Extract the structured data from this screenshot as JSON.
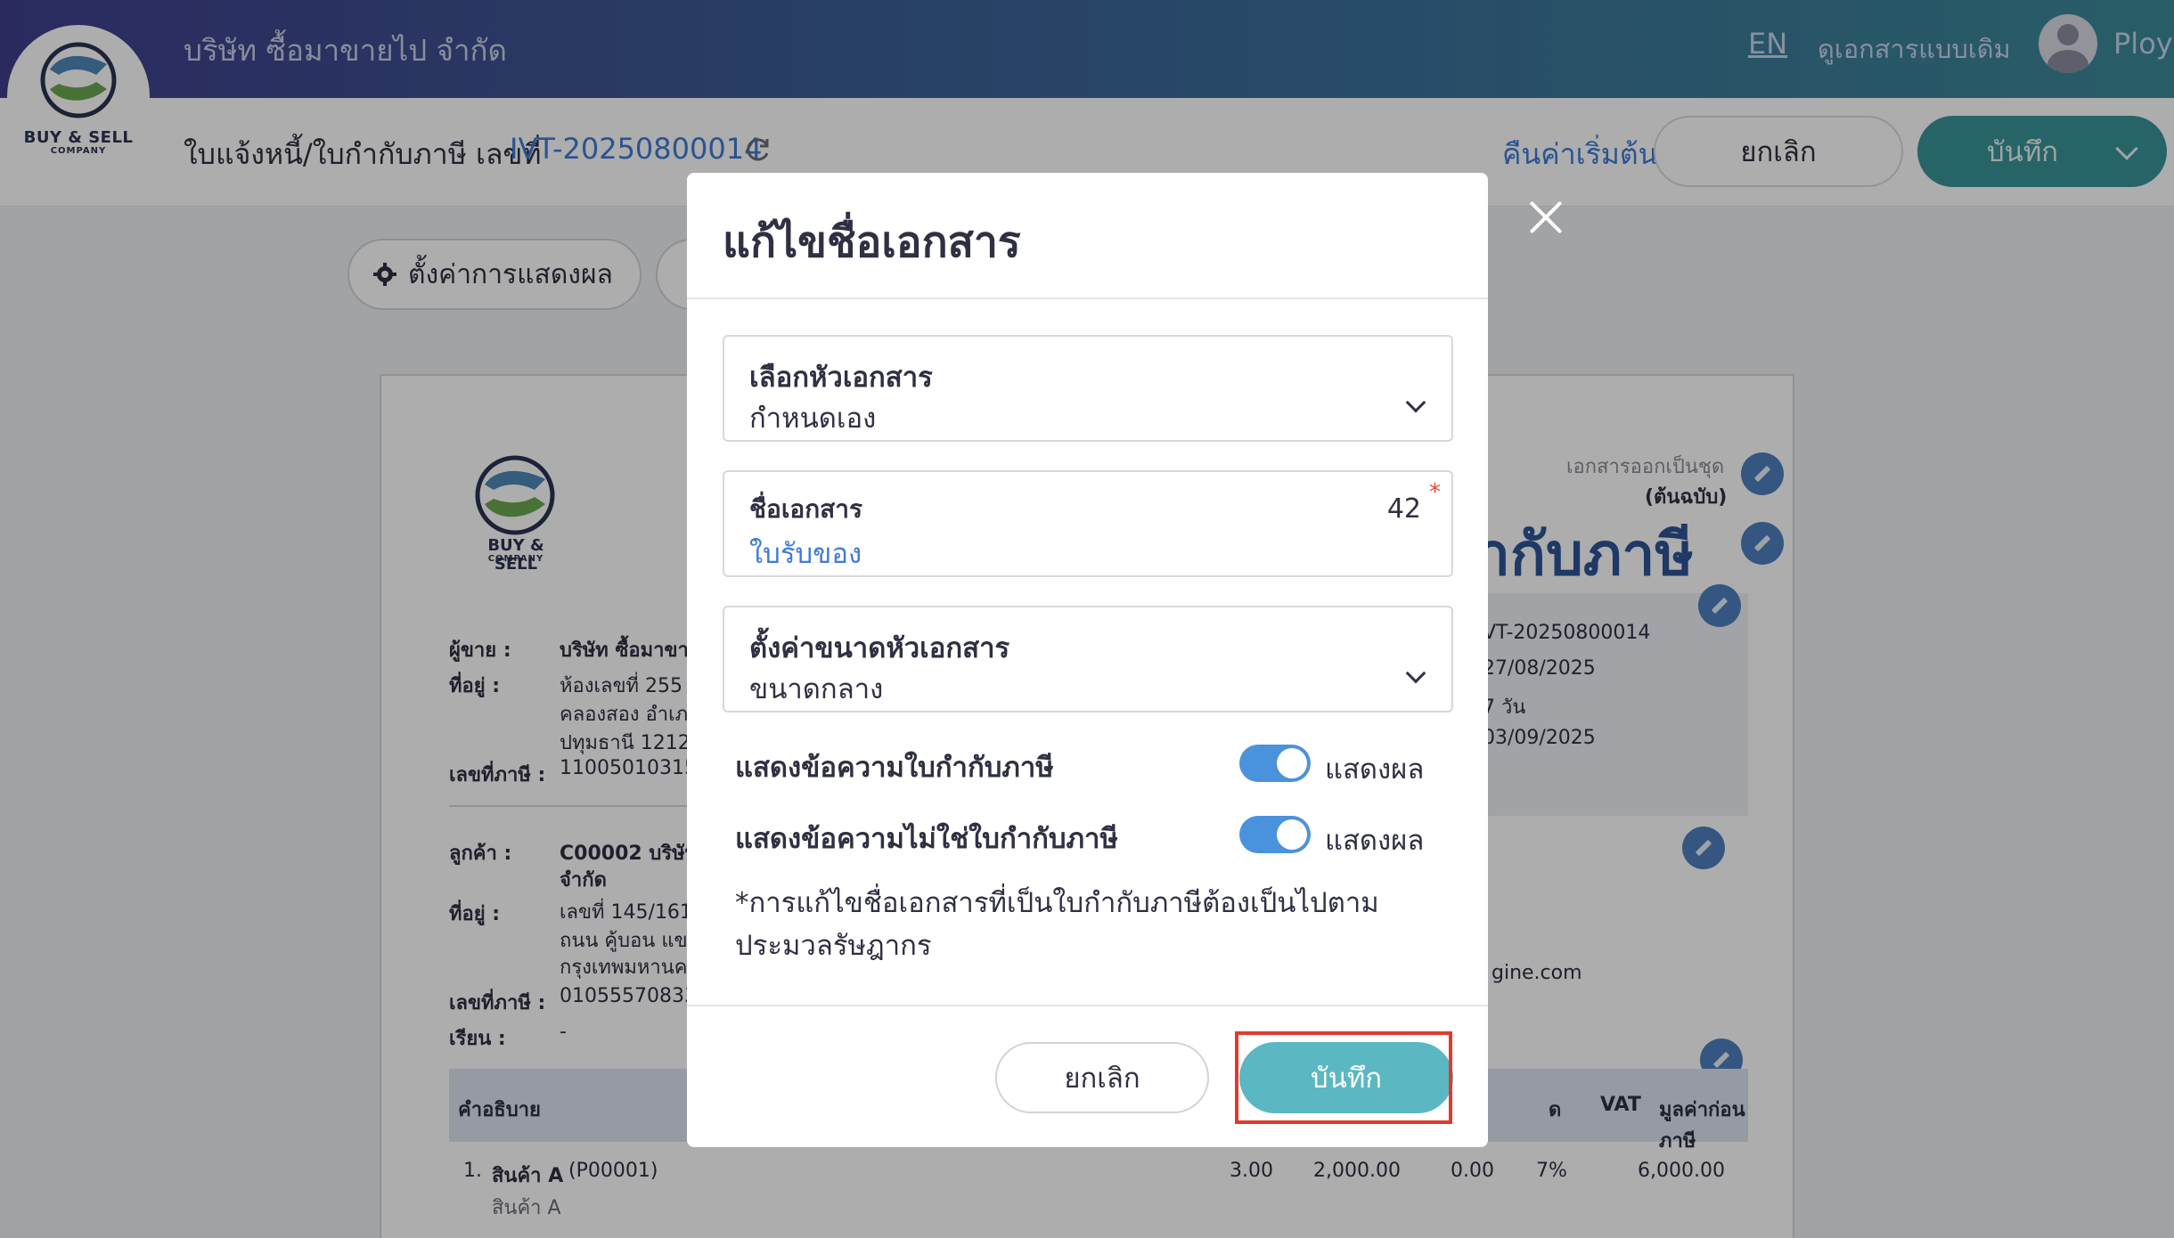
{
  "header": {
    "company_name": "บริษัท ซื้อมาขายไป จำกัด",
    "lang": "EN",
    "classic_view": "ดูเอกสารแบบเดิม",
    "user": "Ploy",
    "logo_line1": "BUY & SELL",
    "logo_line2": "COMPANY"
  },
  "docbar": {
    "label": "ใบแจ้งหนี้/ใบกำกับภาษี เลขที่",
    "number": "IVT-20250800014",
    "reset": "คืนค่าเริ่มต้น",
    "cancel": "ยกเลิก",
    "save": "บันทึก"
  },
  "toolbar": {
    "display_settings": "ตั้งค่าการแสดงผล"
  },
  "paper": {
    "copy_note": "เอกสารออกเป็นชุด",
    "original_note": "(ต้นฉบับ)",
    "title_fragment": "ำกับภาษี",
    "seller_label": "ผู้ขาย :",
    "seller_value": "บริษัท ซื้อมาขา",
    "address_label": "ที่อยู่ :",
    "address_l1": "ห้องเลขที่ 255",
    "address_l2": "คลองสอง อำเภ",
    "address_l3": "ปทุมธานี 1212",
    "tax_label": "เลขที่ภาษี :",
    "tax_value": "11005010315",
    "customer_label": "ลูกค้า :",
    "customer_l1": "C00002 บริษัท",
    "customer_l2": "จำกัด",
    "c_address_label": "ที่อยู่ :",
    "c_address_l1": "เลขที่ 145/161",
    "c_address_l2": "ถนน คู้บอน แข",
    "c_address_l3": "กรุงเทพมหานค",
    "c_tax_label": "เลขที่ภาษี :",
    "c_tax_value": "01055570833",
    "attn_label": "เรียน :",
    "attn_value": "-",
    "meta_number": "VT-20250800014",
    "meta_date": "27/08/2025",
    "meta_terms": "7 วัน",
    "meta_due": "03/09/2025",
    "email_fragment": "gine.com",
    "col_desc": "คำอธิบาย",
    "col_disc": "ด",
    "col_vat": "VAT",
    "col_pretax": "มูลค่าก่อนภาษี",
    "row1_no": "1.",
    "row1_name": "สินค้า A",
    "row1_code": "(P00001)",
    "row1_sub": "สินค้า A",
    "row1_qty": "3.00",
    "row1_price": "2,000.00",
    "row1_disc": "0.00",
    "row1_vat": "7%",
    "row1_total": "6,000.00"
  },
  "modal": {
    "title": "แก้ไขชื่อเอกสาร",
    "header_select_label": "เลือกหัวเอกสาร",
    "header_select_value": "กำหนดเอง",
    "doc_name_label": "ชื่อเอกสาร",
    "doc_name_value": "ใบรับของ",
    "doc_name_count": "42",
    "doc_name_required": "*",
    "size_label": "ตั้งค่าขนาดหัวเอกสาร",
    "size_value": "ขนาดกลาง",
    "toggle1_label": "แสดงข้อความใบกำกับภาษี",
    "toggle1_value": "แสดงผล",
    "toggle2_label": "แสดงข้อความไม่ใช่ใบกำกับภาษี",
    "toggle2_value": "แสดงผล",
    "note": "*การแก้ไขชื่อเอกสารที่เป็นใบกำกับภาษีต้องเป็นไปตามประมวลรัษฎากร",
    "cancel": "ยกเลิก",
    "save": "บันทึก"
  },
  "colors": {
    "accent_teal": "#3a949a",
    "modal_save": "#5bb8c2",
    "link_blue": "#3e7bd6",
    "toggle_on": "#4b92dc",
    "highlight": "#e03a2f"
  }
}
